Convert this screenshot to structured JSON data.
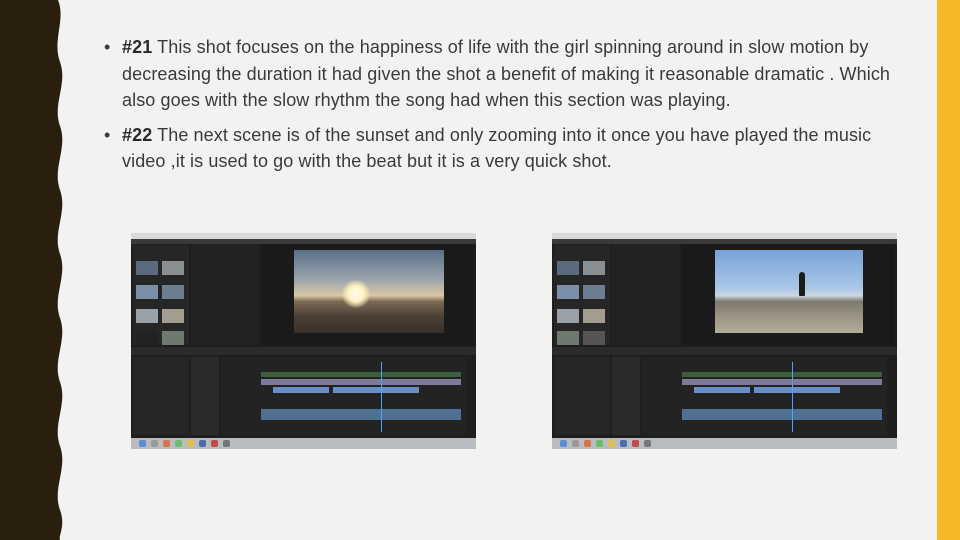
{
  "bullets": [
    {
      "number": "#21",
      "text": " This shot focuses on the happiness of life with the girl spinning around in slow motion by decreasing the duration it had given the shot a benefit of making it reasonable dramatic . Which also goes with the slow rhythm the song had when this section was playing."
    },
    {
      "number": "#22",
      "text": " The next scene is of the sunset and only zooming into it once you have played the music video ,it is used to go with the beat but it is a very quick shot."
    }
  ],
  "bullet_marker": "•",
  "screenshots": [
    {
      "description": "Video editor screenshot showing sunset frame in program monitor"
    },
    {
      "description": "Video editor screenshot showing girl spinning on beach in program monitor"
    }
  ],
  "colors": {
    "accent_bar": "#f6b826",
    "left_border": "#2a1e0f",
    "timecode": "#4aa4ff"
  }
}
